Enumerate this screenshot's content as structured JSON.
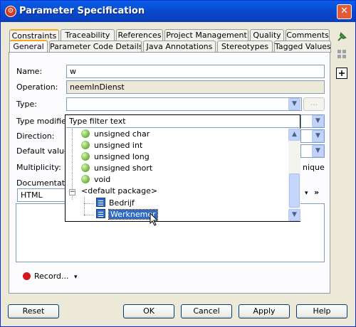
{
  "window": {
    "title": "Parameter Specification",
    "app_icon": "visual-paradigm-icon",
    "close_glyph": "✕"
  },
  "tabs_row1": [
    {
      "label": "Constraints"
    },
    {
      "label": "Traceability"
    },
    {
      "label": "References"
    },
    {
      "label": "Project Management"
    },
    {
      "label": "Quality"
    },
    {
      "label": "Comments"
    }
  ],
  "tabs_row2": [
    {
      "label": "General",
      "active": true
    },
    {
      "label": "Parameter Code Details"
    },
    {
      "label": "Java Annotations"
    },
    {
      "label": "Stereotypes"
    },
    {
      "label": "Tagged Values"
    }
  ],
  "form": {
    "name_label": "Name:",
    "name_value": "w",
    "operation_label": "Operation:",
    "operation_value": "neemInDienst",
    "type_label": "Type:",
    "type_value": "",
    "type_browse": "...",
    "type_modifier_label": "Type modifier:",
    "direction_label": "Direction:",
    "default_value_label": "Default value:",
    "multiplicity_label": "Multiplicity:",
    "unique_label": "nique",
    "documentation_label": "Documentation",
    "doc_format": "HTML",
    "doc_more": "»"
  },
  "record": {
    "label": "Record...",
    "arrow": "▾"
  },
  "buttons": {
    "reset": "Reset",
    "ok": "OK",
    "cancel": "Cancel",
    "apply": "Apply",
    "help": "Help"
  },
  "type_popup": {
    "filter_placeholder": "Type filter text",
    "items": [
      {
        "label": "unsigned char",
        "icon": "primitive-type-icon"
      },
      {
        "label": "unsigned int",
        "icon": "primitive-type-icon"
      },
      {
        "label": "unsigned long",
        "icon": "primitive-type-icon"
      },
      {
        "label": "unsigned short",
        "icon": "primitive-type-icon"
      },
      {
        "label": "void",
        "icon": "primitive-type-icon"
      }
    ],
    "package": {
      "label": "<default package>",
      "expander": "−"
    },
    "classes": [
      {
        "label": "Bedrijf",
        "icon": "class-icon"
      },
      {
        "label": "Werknemer",
        "icon": "class-icon",
        "selected": true
      }
    ]
  },
  "colors": {
    "titlebar": "#0A5EE9",
    "selection": "#316AC5",
    "record_dot": "#D2161B"
  }
}
